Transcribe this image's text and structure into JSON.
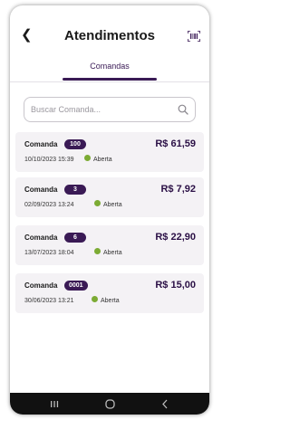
{
  "header": {
    "title": "Atendimentos",
    "back_icon": "chevron-left-icon",
    "action_icon": "barcode-scanner-icon"
  },
  "tabs": [
    {
      "label": "Comandas",
      "active": true
    }
  ],
  "search": {
    "placeholder": "Buscar Comanda...",
    "value": "",
    "icon": "search-icon"
  },
  "comandas": [
    {
      "label": "Comanda",
      "number": "100",
      "amount": "R$ 61,59",
      "datetime": "10/10/2023 15:39",
      "status": "Aberta"
    },
    {
      "label": "Comanda",
      "number": "3",
      "amount": "R$ 7,92",
      "datetime": "02/09/2023 13:24",
      "status": "Aberta"
    },
    {
      "label": "Comanda",
      "number": "6",
      "amount": "R$ 22,90",
      "datetime": "13/07/2023 18:04",
      "status": "Aberta"
    },
    {
      "label": "Comanda",
      "number": "0001",
      "amount": "R$ 15,00",
      "datetime": "30/06/2023 13:21",
      "status": "Aberta"
    }
  ],
  "colors": {
    "primary": "#3a1a55",
    "status_open": "#7cab34",
    "card_bg": "#f4f2f5",
    "navbar": "#111111"
  },
  "navbar": {
    "icons": [
      "recent-apps-icon",
      "home-icon",
      "back-icon"
    ]
  }
}
